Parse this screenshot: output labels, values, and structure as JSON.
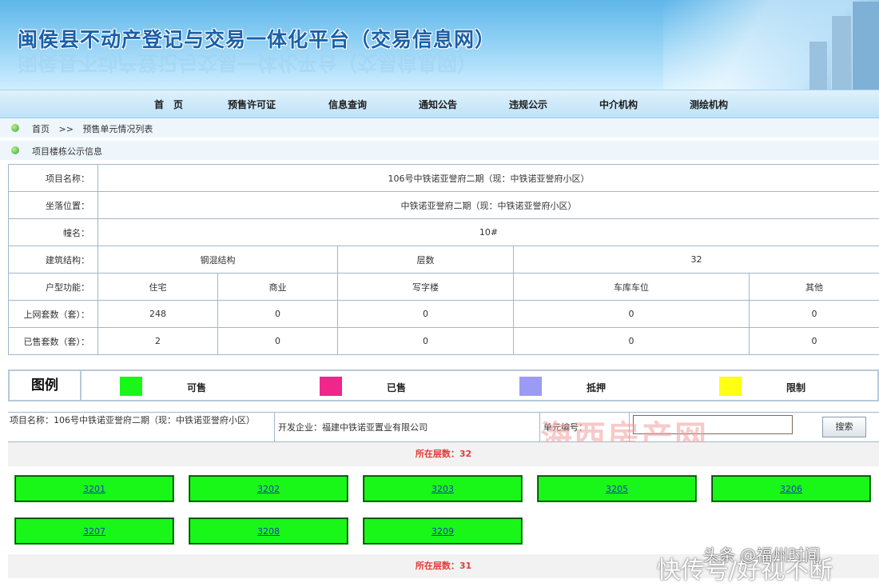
{
  "header": {
    "title": "闽侯县不动产登记与交易一体化平台（交易信息网）"
  },
  "nav": {
    "items": [
      "首　页",
      "预售许可证",
      "信息查询",
      "通知公告",
      "违规公示",
      "中介机构",
      "测绘机构"
    ]
  },
  "breadcrumb": {
    "home": "首页",
    "sep": ">>",
    "current": "预售单元情况列表"
  },
  "section_title": "项目楼栋公示信息",
  "info": {
    "project_label": "项目名称：",
    "project_value": "106号中铁诺亚誉府二期（现：中铁诺亚誉府小区）",
    "location_label": "坐落位置：",
    "location_value": "中铁诺亚誉府二期（现：中铁诺亚誉府小区）",
    "building_label": "幢名：",
    "building_value": "10#",
    "structure_label": "建筑结构：",
    "structure_value": "钢混结构",
    "floors_label": "层数",
    "floors_value": "32",
    "usage_label": "户型功能：",
    "usage_cols": [
      "住宅",
      "商业",
      "写字楼",
      "车库车位",
      "其他"
    ],
    "listed_label": "上网套数（套）：",
    "listed_values": [
      "248",
      "0",
      "0",
      "0",
      "0"
    ],
    "sold_label": "已售套数（套）：",
    "sold_values": [
      "2",
      "0",
      "0",
      "0",
      "0"
    ]
  },
  "legend": {
    "title": "图例",
    "items": [
      {
        "label": "可售",
        "color": "#19f719"
      },
      {
        "label": "已售",
        "color": "#f0268c"
      },
      {
        "label": "抵押",
        "color": "#9b9bf5"
      },
      {
        "label": "限制",
        "color": "#ffff14"
      }
    ]
  },
  "search": {
    "project": "项目名称：106号中铁诺亚誉府二期（现：中铁诺亚誉府小区）",
    "developer": "开发企业：福建中铁诺亚置业有限公司",
    "unit_label": "单元编号：",
    "unit_value": "",
    "button": "搜索"
  },
  "floors": [
    {
      "label": "所在层数：32",
      "units": [
        "3201",
        "3202",
        "3203",
        "3205",
        "3206",
        "3207",
        "3208",
        "3209"
      ]
    },
    {
      "label": "所在层数：31",
      "units": []
    }
  ],
  "watermarks": {
    "brand": "海西房产网",
    "author": "头条 @福州时间",
    "bottom": "快传号/好视不断"
  }
}
